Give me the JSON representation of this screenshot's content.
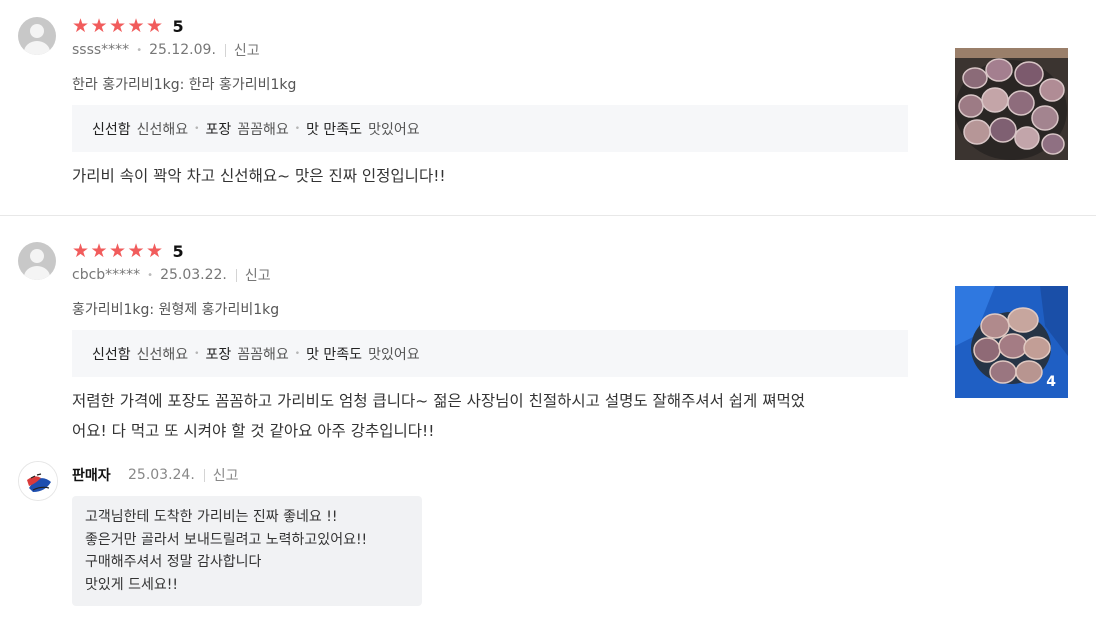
{
  "reviews": [
    {
      "rating": "5",
      "user": "ssss****",
      "date": "25.12.09.",
      "report": "신고",
      "option": "한라 홍가리비1kg: 한라 홍가리비1kg",
      "survey": [
        {
          "key": "신선함",
          "value": "신선해요"
        },
        {
          "key": "포장",
          "value": "꼼꼼해요"
        },
        {
          "key": "맛 만족도",
          "value": "맛있어요"
        }
      ],
      "content_lines": [
        "가리비 속이 꽉악 차고 신선해요~ 맛은 진짜 인정입니다!!"
      ],
      "photo_count": ""
    },
    {
      "rating": "5",
      "user": "cbcb*****",
      "date": "25.03.22.",
      "report": "신고",
      "option": "홍가리비1kg: 원형제 홍가리비1kg",
      "survey": [
        {
          "key": "신선함",
          "value": "신선해요"
        },
        {
          "key": "포장",
          "value": "꼼꼼해요"
        },
        {
          "key": "맛 만족도",
          "value": "맛있어요"
        }
      ],
      "content_lines": [
        "저렴한 가격에 포장도 꼼꼼하고 가리비도 엄청 큽니다~  젊은 사장님이 친절하시고 설명도 잘해주셔서 쉽게 쪄먹었",
        "어요! 다 먹고 또 시켜야 할 것 같아요 아주 강추입니다!!"
      ],
      "photo_count": "4"
    }
  ],
  "seller_reply": {
    "name": "판매자",
    "date": "25.03.24.",
    "report": "신고",
    "lines": [
      "고객님한테 도착한 가리비는 진짜 좋네요 !!",
      "좋은거만 골라서 보내드릴려고 노력하고있어요!!",
      "구매해주셔서 정말 감사합니다",
      "맛있게 드세요!!"
    ]
  },
  "colors": {
    "star": "#f15c5c",
    "survey_bg": "#f6f7f9",
    "reply_bg": "#f1f2f4"
  },
  "icons": {
    "star": "star-icon",
    "avatar": "default-user-avatar-icon",
    "seller_logo": "seller-logo-icon"
  }
}
